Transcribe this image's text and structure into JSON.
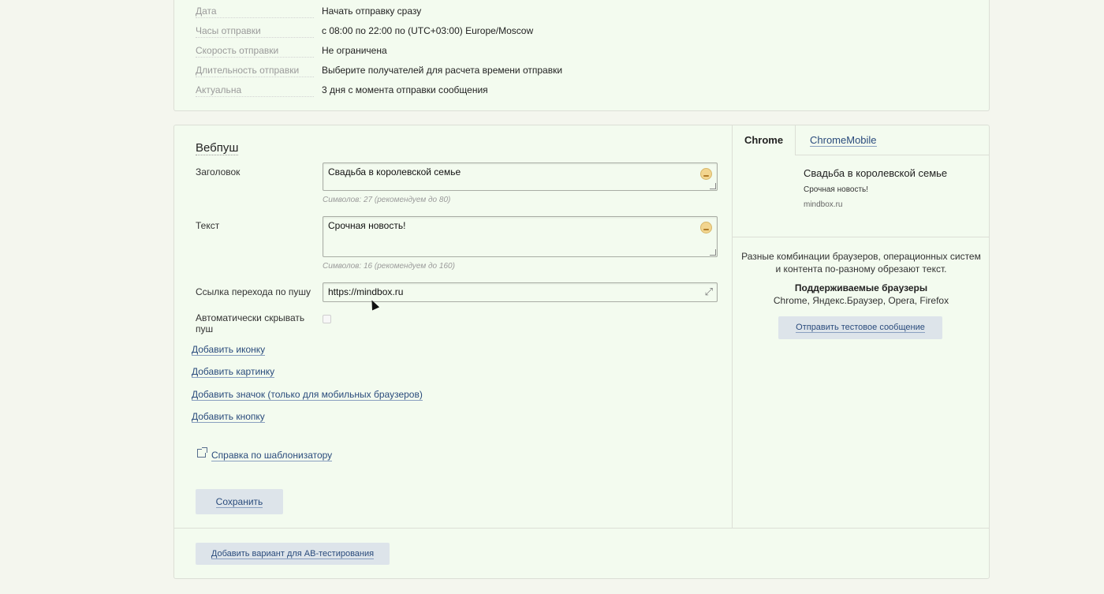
{
  "settings": {
    "rows": [
      {
        "label": "Дата",
        "value": "Начать отправку сразу"
      },
      {
        "label": "Часы отправки",
        "value": "с 08:00 по 22:00 по (UTC+03:00) Europe/Moscow"
      },
      {
        "label": "Скорость отправки",
        "value": "Не ограничена"
      },
      {
        "label": "Длительность отправки",
        "value": "Выберите получателей для расчета времени отправки"
      },
      {
        "label": "Актуальна",
        "value": "3 дня с момента отправки сообщения"
      }
    ]
  },
  "webpush": {
    "section_title": "Вебпуш",
    "title_label": "Заголовок",
    "title_value": "Свадьба в королевской семье",
    "title_counter": "Символов: 27 (рекомендуем до 80)",
    "text_label": "Текст",
    "text_value": "Срочная новость!",
    "text_counter": "Символов: 16 (рекомендуем до 160)",
    "link_label": "Ссылка перехода по пушу",
    "link_value": "https://mindbox.ru",
    "autohide_label": "Автоматически скрывать пуш",
    "autohide_checked": false,
    "add_icon": "Добавить иконку",
    "add_picture": "Добавить картинку",
    "add_badge": "Добавить значок (только для мобильных браузеров)",
    "add_button": "Добавить кнопку",
    "help_link": "Справка по шаблонизатору",
    "save_button": "Сохранить"
  },
  "preview": {
    "tabs": [
      "Chrome",
      "ChromeMobile"
    ],
    "active_tab": "Chrome",
    "push_title": "Свадьба в королевской семье",
    "push_body": "Срочная новость!",
    "push_domain": "mindbox.ru",
    "note_line1": "Разные комбинации браузеров, операционных систем",
    "note_line2": "и контента по-разному обрезают текст.",
    "supported_title": "Поддерживаемые браузеры",
    "supported_list": "Chrome, Яндекс.Браузер, Opera, Firefox",
    "test_button": "Отправить тестовое сообщение"
  },
  "ab_button": "Добавить вариант для АВ-тестирования"
}
